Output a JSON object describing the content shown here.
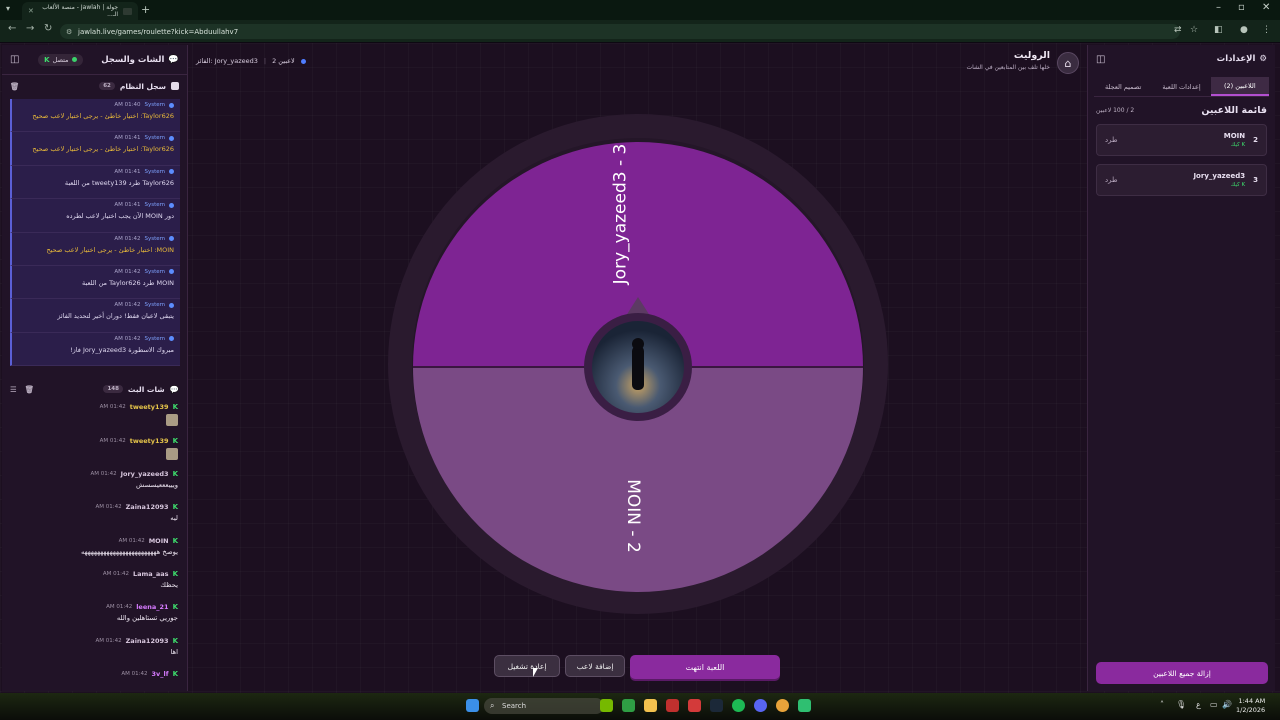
{
  "browser": {
    "tab_title": "جولة | Jawlah - منصة الألعاب الـ...",
    "url": "jawlah.live/games/roulette?kick=Abduullahv7"
  },
  "left_panel": {
    "title": "الشات والسجل",
    "status": "متصل",
    "system_log": {
      "title": "سجل النظام",
      "count": "62",
      "items": [
        {
          "time": "01:40 AM",
          "who": "System",
          "text": "Taylor626: اختيار خاطئ - يرجى اختيار لاعب صحيح",
          "warn": true
        },
        {
          "time": "01:41 AM",
          "who": "System",
          "text": "Taylor626: اختيار خاطئ - يرجى اختيار لاعب صحيح",
          "warn": true
        },
        {
          "time": "01:41 AM",
          "who": "System",
          "text": "Taylor626 طرد tweety139 من اللعبة",
          "warn": false
        },
        {
          "time": "01:41 AM",
          "who": "System",
          "text": "دور MOIN الآن يجب اختيار لاعب لطرده",
          "warn": false
        },
        {
          "time": "01:42 AM",
          "who": "System",
          "text": "MOIN: اختيار خاطئ - يرجى اختيار لاعب صحيح",
          "warn": true
        },
        {
          "time": "01:42 AM",
          "who": "System",
          "text": "MOIN طرد Taylor626 من اللعبة",
          "warn": false
        },
        {
          "time": "01:42 AM",
          "who": "System",
          "text": "يتبقى لاعبان فقط! دوران أخير لتحديد الفائز",
          "warn": false
        },
        {
          "time": "01:42 AM",
          "who": "System",
          "text": "مبروك الاسطورة Jory_yazeed3 فاز!",
          "warn": false
        }
      ]
    },
    "live_chat": {
      "title": "شات البث",
      "count": "148",
      "items": [
        {
          "time": "01:42 AM",
          "name": "tweety139",
          "text": "",
          "emote": true,
          "color": "gold"
        },
        {
          "time": "01:42 AM",
          "name": "tweety139",
          "text": "",
          "emote": true,
          "color": "gold"
        },
        {
          "time": "01:42 AM",
          "name": "Jory_yazeed3",
          "text": "ويييعععيسسش",
          "emote": false,
          "color": ""
        },
        {
          "time": "01:42 AM",
          "name": "Zaina12093",
          "text": "ليه",
          "emote": false,
          "color": ""
        },
        {
          "time": "01:42 AM",
          "name": "MOIN",
          "text": "يوصخ ههههههههههههههههههههههههه",
          "emote": false,
          "color": ""
        },
        {
          "time": "01:42 AM",
          "name": "Lama_aas",
          "text": "يحظك",
          "emote": false,
          "color": ""
        },
        {
          "time": "01:42 AM",
          "name": "leena_21",
          "text": "جوريي تستاهلين والله",
          "emote": false,
          "color": "pink"
        },
        {
          "time": "01:42 AM",
          "name": "Zaina12093",
          "text": "اها",
          "emote": false,
          "color": ""
        },
        {
          "time": "01:42 AM",
          "name": "3v_lf",
          "text": "",
          "emote": false,
          "color": "pink"
        }
      ]
    }
  },
  "center": {
    "players_count": "2 لاعبين",
    "winner": "الفائز: Jory_yazeed3",
    "game_title": "الروليت",
    "game_subtitle": "خلها تلف بين المتابعين في الشات",
    "wheel": {
      "segments": [
        {
          "label": "Jory_yazeed3 - 3",
          "color": "#7e2493"
        },
        {
          "label": "MOIN - 2",
          "color": "#7a4a85"
        }
      ]
    },
    "btn_end": "اللعبة انتهت",
    "btn_add": "إضافة لاعب",
    "btn_replay": "إعادة تشغيل"
  },
  "right_panel": {
    "title": "الإعدادات",
    "tabs": [
      "اللاعبين (2)",
      "إعدادات اللعبة",
      "تصميم العجلة"
    ],
    "players_title": "قائمة اللاعبين",
    "players_count": "2 / 100 لاعبين",
    "players": [
      {
        "num": "2",
        "name": "MOIN",
        "sub": "كيك",
        "kick": "طرد"
      },
      {
        "num": "3",
        "name": "Jory_yazeed3",
        "sub": "كيك",
        "kick": "طرد"
      }
    ],
    "remove_all": "إزالة جميع اللاعبين"
  },
  "taskbar": {
    "search": "Search",
    "time": "1:44 AM",
    "date": "1/2/2026",
    "lang": "ع"
  },
  "colors": {
    "accent": "#8a2a9e",
    "kick_green": "#3ddf6d"
  }
}
